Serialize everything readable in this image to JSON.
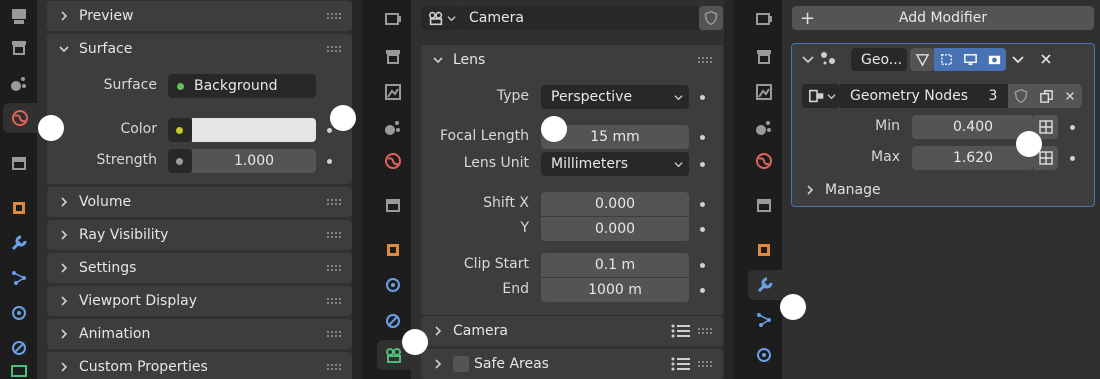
{
  "left_panel": {
    "sections": [
      {
        "label": "Preview",
        "expanded": false
      },
      {
        "label": "Surface",
        "expanded": true
      },
      {
        "label": "Volume",
        "expanded": false
      },
      {
        "label": "Ray Visibility",
        "expanded": false
      },
      {
        "label": "Settings",
        "expanded": false
      },
      {
        "label": "Viewport Display",
        "expanded": false
      },
      {
        "label": "Animation",
        "expanded": false
      },
      {
        "label": "Custom Properties",
        "expanded": false
      }
    ],
    "surface": {
      "surface_label": "Surface",
      "surface_value": "Background",
      "color_label": "Color",
      "strength_label": "Strength",
      "strength_value": "1.000"
    }
  },
  "middle_panel": {
    "data_name": "Camera",
    "lens": {
      "header": "Lens",
      "type_label": "Type",
      "type_value": "Perspective",
      "focal_length_label": "Focal Length",
      "focal_length_value": "15 mm",
      "lens_unit_label": "Lens Unit",
      "lens_unit_value": "Millimeters",
      "shift_x_label": "Shift X",
      "shift_x_value": "0.000",
      "shift_y_label": "Y",
      "shift_y_value": "0.000",
      "clip_start_label": "Clip Start",
      "clip_start_value": "0.1 m",
      "clip_end_label": "End",
      "clip_end_value": "1000 m"
    },
    "camera_section": "Camera",
    "safe_areas_section": "Safe Areas"
  },
  "right_panel": {
    "add_modifier": "Add Modifier",
    "modifier_name": "Geo...",
    "node_group": "Geometry Nodes",
    "users_count": "3",
    "min_label": "Min",
    "min_value": "0.400",
    "max_label": "Max",
    "max_value": "1.620",
    "manage_label": "Manage"
  },
  "colors": {
    "active_tab_icon": "#e0645a",
    "accent_blue": "#4772b3",
    "surface_dot": "#63c05a",
    "color_dot": "#c7c729"
  }
}
